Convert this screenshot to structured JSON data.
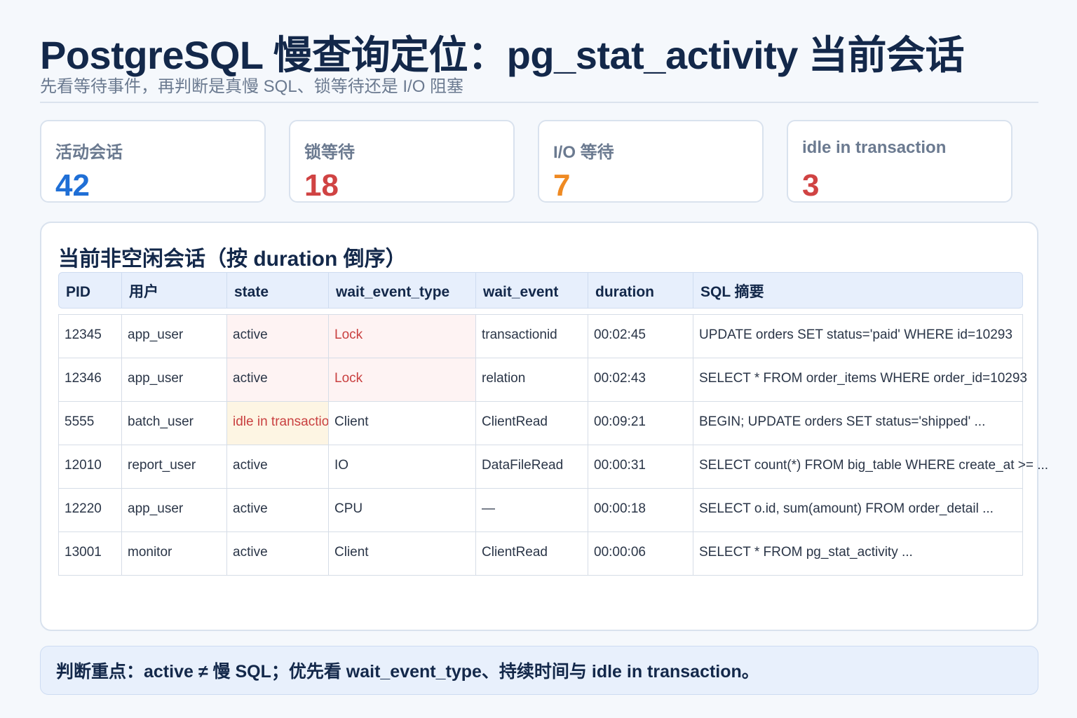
{
  "header": {
    "title": "PostgreSQL 慢查询定位：pg_stat_activity 当前会话",
    "subtitle": "先看等待事件，再判断是真慢 SQL、锁等待还是 I/O 阻塞"
  },
  "stats": [
    {
      "label": "活动会话",
      "value": "42",
      "color": "#1f6fd6"
    },
    {
      "label": "锁等待",
      "value": "18",
      "color": "#d04343"
    },
    {
      "label": "I/O 等待",
      "value": "7",
      "color": "#ef8a22"
    },
    {
      "label": "idle in transaction",
      "value": "3",
      "color": "#d04343"
    }
  ],
  "panel": {
    "title": "当前非空闲会话（按 duration 倒序）",
    "columns": [
      "PID",
      "用户",
      "state",
      "wait_event_type",
      "wait_event",
      "duration",
      "SQL 摘要"
    ],
    "rows": [
      {
        "pid": "12345",
        "user": "app_user",
        "state": "active",
        "wait_event_type": "Lock",
        "wait_event": "transactionid",
        "duration": "00:02:45",
        "sql": "UPDATE orders SET status='paid' WHERE id=10293"
      },
      {
        "pid": "12346",
        "user": "app_user",
        "state": "active",
        "wait_event_type": "Lock",
        "wait_event": "relation",
        "duration": "00:02:43",
        "sql": "SELECT * FROM order_items WHERE order_id=10293"
      },
      {
        "pid": "5555",
        "user": "batch_user",
        "state": "idle in transaction",
        "wait_event_type": "Client",
        "wait_event": "ClientRead",
        "duration": "00:09:21",
        "sql": "BEGIN; UPDATE orders SET status='shipped' ..."
      },
      {
        "pid": "12010",
        "user": "report_user",
        "state": "active",
        "wait_event_type": "IO",
        "wait_event": "DataFileRead",
        "duration": "00:00:31",
        "sql": "SELECT count(*) FROM big_table WHERE create_at >= ..."
      },
      {
        "pid": "12220",
        "user": "app_user",
        "state": "active",
        "wait_event_type": "CPU",
        "wait_event": "—",
        "duration": "00:00:18",
        "sql": "SELECT o.id, sum(amount) FROM order_detail ..."
      },
      {
        "pid": "13001",
        "user": "monitor",
        "state": "active",
        "wait_event_type": "Client",
        "wait_event": "ClientRead",
        "duration": "00:00:06",
        "sql": "SELECT * FROM pg_stat_activity ..."
      }
    ]
  },
  "note": {
    "text": "判断重点：active ≠ 慢 SQL；优先看 wait_event_type、持续时间与 idle in transaction。"
  }
}
